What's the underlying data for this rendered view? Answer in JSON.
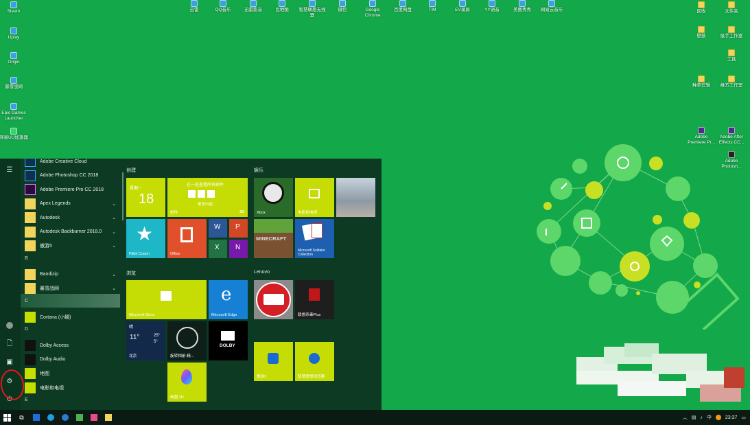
{
  "desktop_left": [
    {
      "label": "Steam",
      "icon": "steam-icon"
    },
    {
      "label": "Uplay",
      "icon": "uplay-icon"
    },
    {
      "label": "Origin",
      "icon": "origin-icon"
    },
    {
      "label": "暴雪战网",
      "icon": "battlenet-icon"
    },
    {
      "label": "Epic Games Launcher",
      "icon": "epic-icon"
    },
    {
      "label": "网易UU加速器",
      "icon": "uu-icon"
    }
  ],
  "desktop_top": [
    {
      "label": "迅雷",
      "icon": "xunlei-icon"
    },
    {
      "label": "QQ音乐",
      "icon": "qqmusic-icon"
    },
    {
      "label": "迅雷影音",
      "icon": "xunlei-player-icon"
    },
    {
      "label": "比地图",
      "icon": "map-icon"
    },
    {
      "label": "智慧联想无线器",
      "icon": "lenovo-icon"
    },
    {
      "label": "微信",
      "icon": "wechat-icon"
    },
    {
      "label": "Google Chrome",
      "icon": "chrome-icon"
    },
    {
      "label": "百度网盘",
      "icon": "baidu-pan-icon"
    },
    {
      "label": "TIM",
      "icon": "tim-icon"
    },
    {
      "label": "EV录屏",
      "icon": "ev-icon"
    },
    {
      "label": "YY语音",
      "icon": "yy-icon"
    },
    {
      "label": "美图秀秀",
      "icon": "meitu-icon"
    },
    {
      "label": "网易云音乐",
      "icon": "netease-music-icon"
    }
  ],
  "desktop_right": [
    {
      "label": "回收",
      "icon": "folder-icon"
    },
    {
      "label": "文件夹",
      "icon": "folder-icon"
    },
    {
      "label": "壁纸",
      "icon": "folder-icon"
    },
    {
      "label": "接手工作室",
      "icon": "folder-icon"
    },
    {
      "label": "工具",
      "icon": "folder-icon"
    },
    {
      "label": "种草剪辑",
      "icon": "folder-icon"
    },
    {
      "label": "推方工作室",
      "icon": "folder-icon"
    },
    {
      "label": "Adobe Premiere Pr...",
      "icon": "premiere-icon"
    },
    {
      "label": "Adobe After Effects CC...",
      "icon": "after-effects-icon"
    },
    {
      "label": "Adobe Photosh...",
      "icon": "photoshop-icon"
    }
  ],
  "start": {
    "apps": [
      {
        "label": "Adobe Creative Cloud",
        "icon": "ps"
      },
      {
        "label": "Adobe Photoshop CC 2018",
        "icon": "ps"
      },
      {
        "label": "Adobe Premiere Pro CC 2018",
        "icon": "pr"
      },
      {
        "label": "Apex Legends",
        "icon": "folder",
        "chev": "⌄"
      },
      {
        "label": "Autodesk",
        "icon": "folder",
        "chev": "⌄"
      },
      {
        "label": "Autodesk Backburner 2018.0",
        "icon": "folder",
        "chev": "⌄"
      },
      {
        "label": "傲游5",
        "icon": "folder",
        "chev": "⌄"
      },
      {
        "label": "B",
        "letter": true
      },
      {
        "label": "Bandizip",
        "icon": "folder",
        "chev": "⌄"
      },
      {
        "label": "暴雪战网",
        "icon": "folder",
        "chev": "⌄"
      },
      {
        "label": "C",
        "letter": true
      },
      {
        "label": "Cortana (小娜)",
        "icon": "cortana"
      },
      {
        "label": "D",
        "letter": true
      },
      {
        "label": "Dolby Access",
        "icon": "dolby"
      },
      {
        "label": "Dolby Audio",
        "icon": "dolby"
      },
      {
        "label": "地图",
        "icon": "map"
      },
      {
        "label": "电影和电视",
        "icon": "movies"
      },
      {
        "label": "E",
        "letter": true
      }
    ],
    "groups": {
      "create": "创建",
      "entertain": "娱乐",
      "browse": "浏览",
      "lenovo": "Lenovo"
    },
    "tiles": {
      "calendar_day": "星期一",
      "calendar_date": "18",
      "mail_title": "在一处查看所有邮件",
      "mail_label": "邮件",
      "mail_more": "更多内容...",
      "xbox": "Xbox",
      "movies": "电影和电视",
      "fitbit": "Fitbit Coach",
      "office": "Office",
      "minecraft": "MINECRAFT",
      "solitaire": "Microsoft Solitaire Collection",
      "store": "Microsoft Store",
      "edge": "Microsoft Edge",
      "weather_cond": "晴",
      "weather_temp": "11°",
      "weather_hi": "25°",
      "weather_lo": "5°",
      "weather_city": "北京",
      "dolby": "DOLBY",
      "dolby_label": "",
      "camera_label": "旋转相册-精...",
      "paint3d": "画图 3D",
      "lenovo_vantage": "",
      "mcafee": "联想杀毒Plus",
      "tile_a": "傲游5",
      "tile_b": "智慧联想浏览器"
    }
  },
  "taskbar": {
    "time": "23:37",
    "ime": "中"
  },
  "colors": {
    "desktop": "#13a84a",
    "accent_lime": "#c6dd05",
    "start_bg": "#0c3a22"
  }
}
